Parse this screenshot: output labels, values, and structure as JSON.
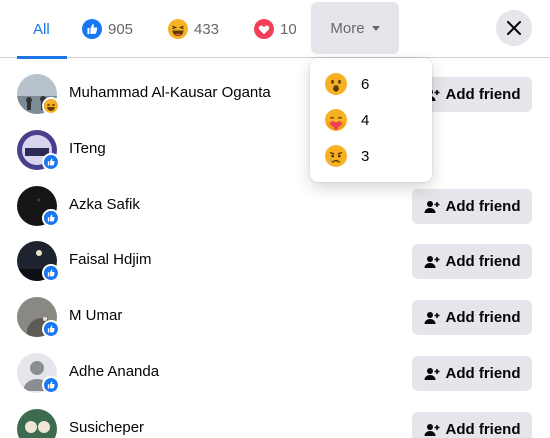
{
  "tabs": [
    {
      "label": "All",
      "icon": "all"
    },
    {
      "label": "905",
      "icon": "like-reaction-icon"
    },
    {
      "label": "433",
      "icon": "haha-reaction-icon"
    },
    {
      "label": "10",
      "icon": "love-reaction-icon"
    }
  ],
  "more_label": "More",
  "dropdown": [
    {
      "count": "6",
      "icon": "wow-reaction-icon"
    },
    {
      "count": "4",
      "icon": "care-reaction-icon"
    },
    {
      "count": "3",
      "icon": "sad-reaction-icon"
    }
  ],
  "add_friend_label": "Add friend",
  "people": [
    {
      "name": "Muhammad Al-Kausar Oganta",
      "reaction": "haha",
      "avatar_color": "#9aa7b4"
    },
    {
      "name": "ITeng",
      "reaction": "like",
      "avatar_color": "#4a3f8c"
    },
    {
      "name": "Azka Safik",
      "reaction": "like",
      "avatar_color": "#151515"
    },
    {
      "name": "Faisal Hdjim",
      "reaction": "like",
      "avatar_color": "#1d2430"
    },
    {
      "name": "M Umar",
      "reaction": "like",
      "avatar_color": "#8a8882"
    },
    {
      "name": "Adhe Ananda",
      "reaction": "like",
      "avatar_color": "#c9ccd1"
    },
    {
      "name": "Susicheper",
      "reaction": "like",
      "avatar_color": "#3d6b4f"
    }
  ],
  "colors": {
    "accent": "#1b74e4",
    "button_bg": "#e4e6eb",
    "like_blue": "#1877f2",
    "love_red": "#f33e58"
  }
}
